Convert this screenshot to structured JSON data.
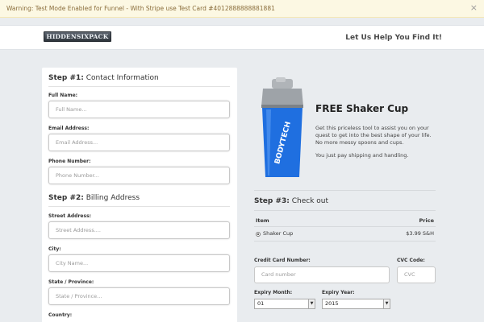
{
  "warning": {
    "text": "Warning: Test Mode Enabled for Funnel - With Stripe use Test Card #4012888888881881",
    "close_glyph": "×"
  },
  "header": {
    "logo_text": "HIDDENSIXPACK",
    "tagline": "Let Us Help You Find It!"
  },
  "contact": {
    "step_num": "Step #1:",
    "step_title": "Contact Information",
    "fields": [
      {
        "label": "Full Name:",
        "placeholder": "Full Name..."
      },
      {
        "label": "Email Address:",
        "placeholder": "Email Address..."
      },
      {
        "label": "Phone Number:",
        "placeholder": "Phone Number..."
      }
    ]
  },
  "billing": {
    "step_num": "Step #2:",
    "step_title": "Billing Address",
    "fields": [
      {
        "label": "Street Address:",
        "placeholder": "Street Address...."
      },
      {
        "label": "City:",
        "placeholder": "City Name..."
      },
      {
        "label": "State / Province:",
        "placeholder": "State / Province..."
      },
      {
        "label": "Country:",
        "placeholder": ""
      }
    ]
  },
  "offer": {
    "title": "FREE Shaker Cup",
    "description": "Get this priceless tool to assist you on your quest to get into the best shape of your life. No more messy spoons and cups.",
    "pay_note": "You just pay shipping and handling.",
    "product_brand": "BODYTECH",
    "colors": {
      "cup": "#1f6fe0",
      "lid": "#9ea3a8"
    }
  },
  "checkout": {
    "step_num": "Step #3:",
    "step_title": "Check out",
    "table": {
      "col_item": "Item",
      "col_price": "Price",
      "rows": [
        {
          "item": "Shaker Cup",
          "price": "$3.99 S&H"
        }
      ]
    },
    "card_label": "Credit Card Number:",
    "card_placeholder": "Card number",
    "cvc_label": "CVC Code:",
    "cvc_placeholder": "CVC",
    "month_label": "Expiry Month:",
    "month_value": "01",
    "year_label": "Expiry Year:",
    "year_value": "2015",
    "select_arrow": "▼"
  }
}
